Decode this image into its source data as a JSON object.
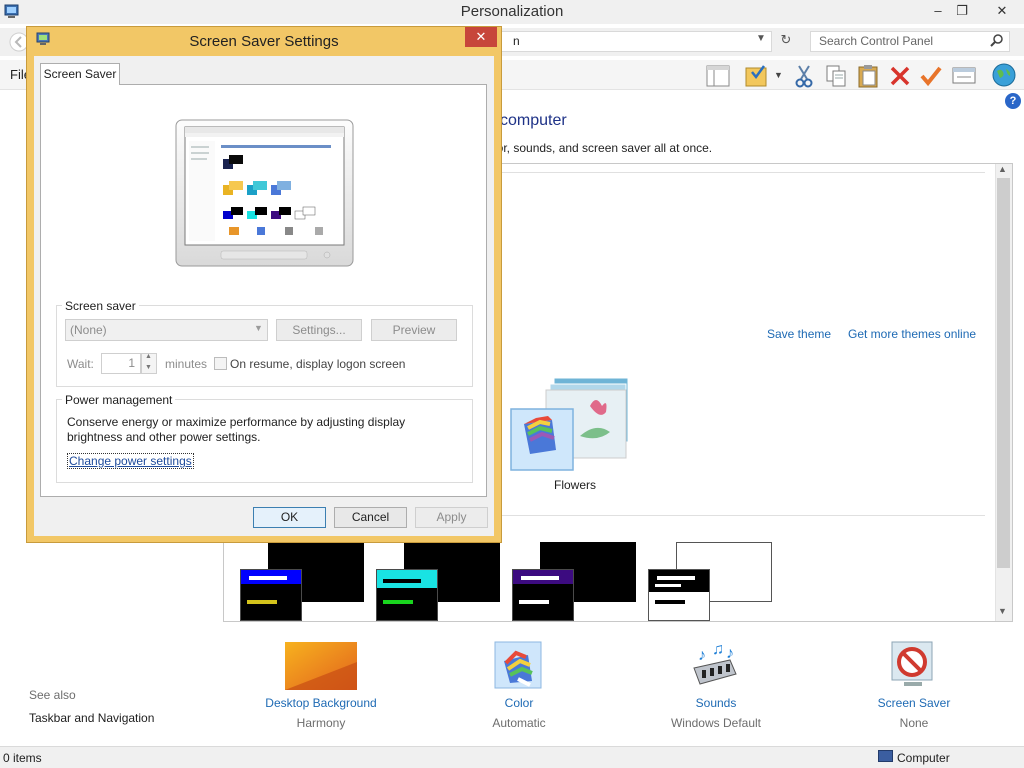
{
  "window": {
    "title": "Personalization",
    "address_text": "n",
    "search_placeholder": "Search Control Panel",
    "file_menu": "File",
    "minimize": "–",
    "restore": "❐",
    "close": "✕"
  },
  "panel": {
    "heading": "computer",
    "subtext": "lor, sounds, and screen saver all at once.",
    "save_theme": "Save theme",
    "more_themes": "Get more themes online",
    "flowers_label": "Flowers"
  },
  "see_also": {
    "label": "See also",
    "taskbar": "Taskbar and Navigation"
  },
  "quick_links": [
    {
      "title": "Desktop Background",
      "sub": "Harmony"
    },
    {
      "title": "Color",
      "sub": "Automatic"
    },
    {
      "title": "Sounds",
      "sub": "Windows Default"
    },
    {
      "title": "Screen Saver",
      "sub": "None"
    }
  ],
  "status": {
    "items": "0 items",
    "location": "Computer"
  },
  "dialog": {
    "title": "Screen Saver Settings",
    "close": "✕",
    "tab": "Screen Saver",
    "screensaver_group": "Screen saver",
    "selected": "(None)",
    "settings_btn": "Settings...",
    "preview_btn": "Preview",
    "wait_label": "Wait:",
    "wait_value": "1",
    "minutes_label": "minutes",
    "resume_label": "On resume, display logon screen",
    "power_group": "Power management",
    "power_desc": "Conserve energy or maximize performance by adjusting display brightness and other power settings.",
    "power_link": "Change power settings",
    "ok": "OK",
    "cancel": "Cancel",
    "apply": "Apply"
  },
  "colors": {
    "dialog_frame": "#f2c766",
    "close_red": "#c7463b",
    "link_blue": "#1e6ab4"
  }
}
